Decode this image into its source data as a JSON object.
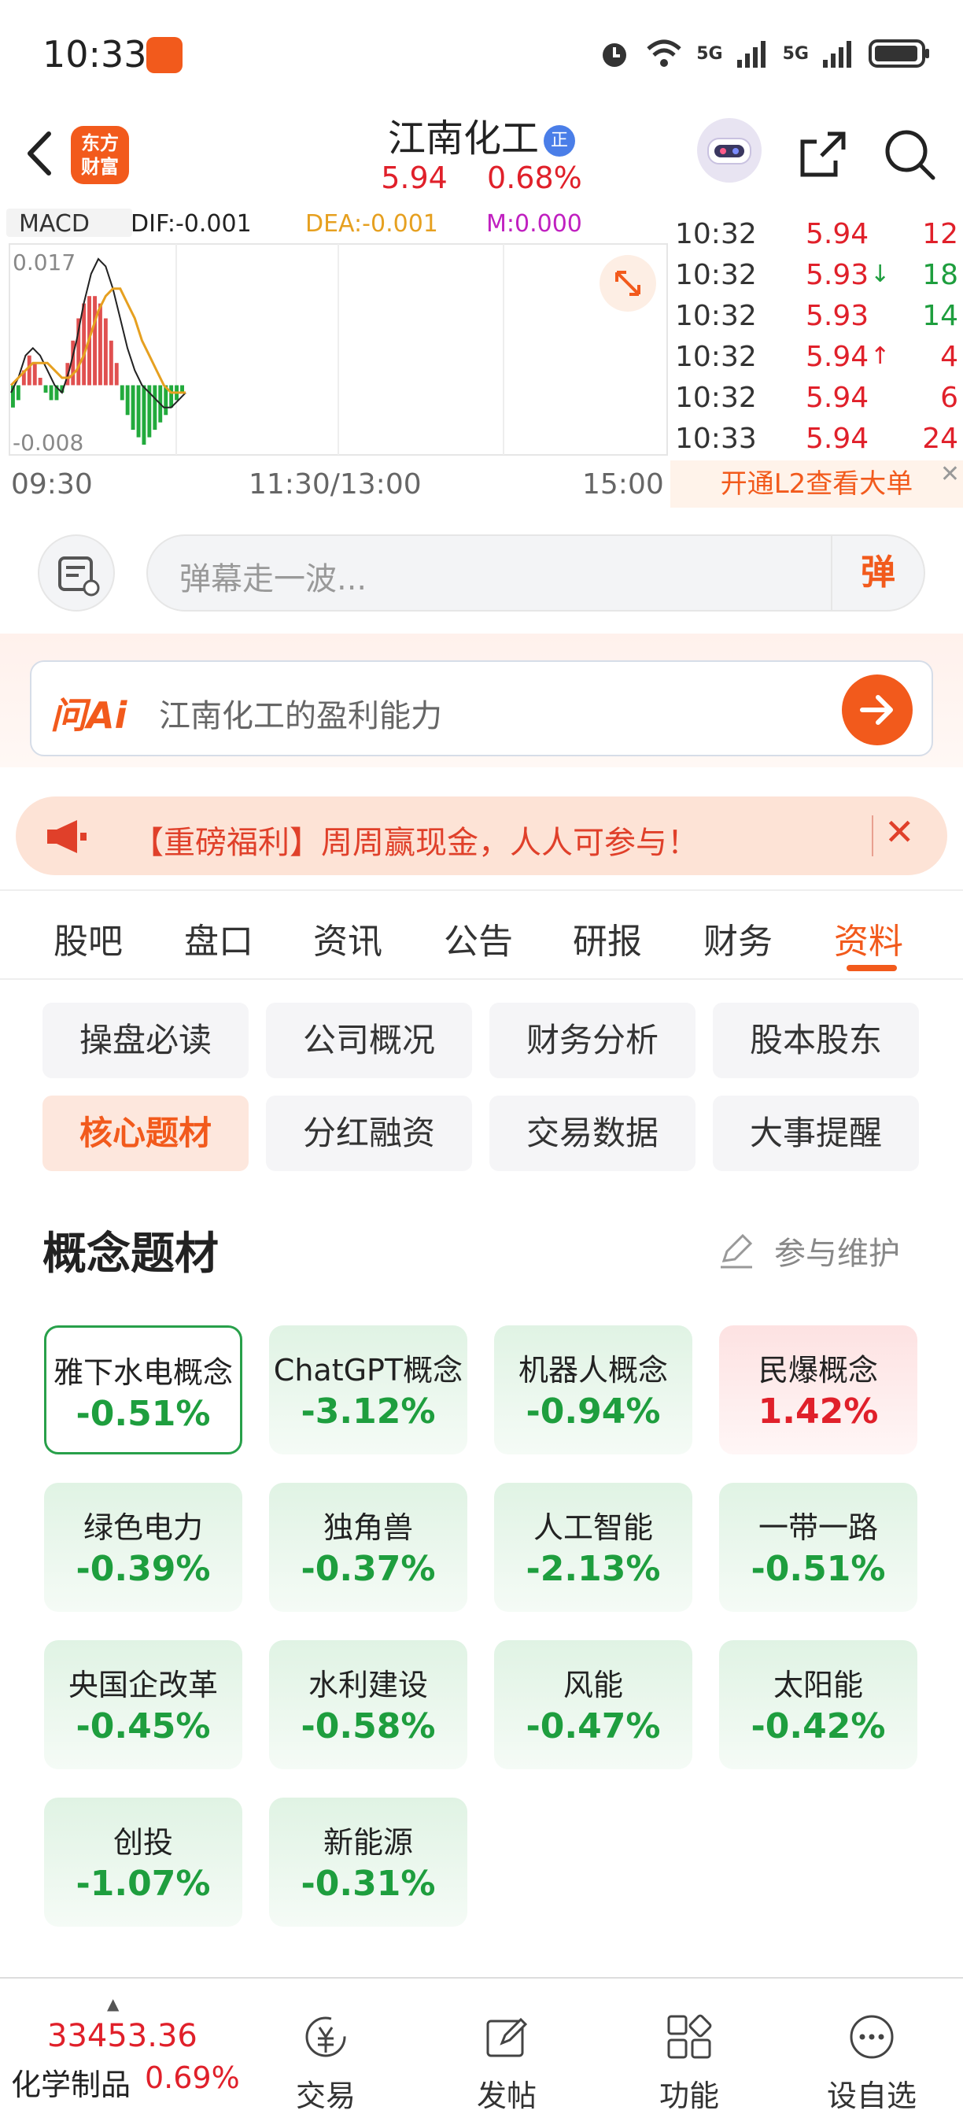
{
  "status_bar": {
    "time": "10:33",
    "net1": "5G",
    "net2": "5G"
  },
  "header": {
    "logo_text": [
      "东方",
      "财富"
    ],
    "stock_name": "江南化工",
    "badge": "正",
    "price": "5.94",
    "change_pct": "0.68%"
  },
  "chart": {
    "indicator": "MACD",
    "dif_label": "DIF:-0.001",
    "dea_label": "DEA:-0.001",
    "m_label": "M:0.000",
    "y_max_label": "0.017",
    "y_min_label": "-0.008",
    "x_labels": [
      "09:30",
      "11:30/13:00",
      "15:00"
    ]
  },
  "chart_data": {
    "type": "bar",
    "title": "MACD",
    "xlabel": "",
    "ylabel": "",
    "ylim": [
      -0.008,
      0.017
    ],
    "x_ticks": [
      "09:30",
      "11:30/13:00",
      "15:00"
    ],
    "histogram": [
      -0.003,
      -0.002,
      0.002,
      0.004,
      0.003,
      0.001,
      -0.001,
      -0.002,
      -0.002,
      -0.001,
      0.003,
      0.006,
      0.009,
      0.011,
      0.012,
      0.012,
      0.011,
      0.009,
      0.006,
      0.003,
      -0.002,
      -0.004,
      -0.006,
      -0.007,
      -0.008,
      -0.007,
      -0.006,
      -0.005,
      -0.004,
      -0.003,
      -0.002,
      -0.001
    ],
    "series": [
      {
        "name": "DIF",
        "values": [
          -0.001,
          0.001,
          0.004,
          0.005,
          0.004,
          0.002,
          0.0,
          -0.001,
          0.002,
          0.006,
          0.011,
          0.015,
          0.017,
          0.016,
          0.013,
          0.009,
          0.005,
          0.002,
          0.0,
          -0.001,
          -0.002,
          -0.003,
          -0.003,
          -0.002,
          -0.001
        ]
      },
      {
        "name": "DEA",
        "values": [
          0.0,
          0.001,
          0.002,
          0.003,
          0.003,
          0.003,
          0.002,
          0.001,
          0.001,
          0.002,
          0.004,
          0.007,
          0.01,
          0.012,
          0.013,
          0.013,
          0.011,
          0.009,
          0.006,
          0.004,
          0.002,
          0.0,
          -0.001,
          -0.001,
          -0.001
        ]
      }
    ]
  },
  "trades": [
    {
      "time": "10:32",
      "price": "5.94",
      "volume": "12",
      "dir": ""
    },
    {
      "time": "10:32",
      "price": "5.93",
      "volume": "18",
      "dir": "down"
    },
    {
      "time": "10:32",
      "price": "5.93",
      "volume": "14",
      "dir": ""
    },
    {
      "time": "10:32",
      "price": "5.94",
      "volume": "4",
      "dir": "up"
    },
    {
      "time": "10:32",
      "price": "5.94",
      "volume": "6",
      "dir": ""
    },
    {
      "time": "10:33",
      "price": "5.94",
      "volume": "24",
      "dir": ""
    }
  ],
  "l2_banner": "开通L2查看大单",
  "danmu": {
    "placeholder": "弹幕走一波...",
    "button": "弹"
  },
  "ai": {
    "logo": "问Ai",
    "question": "江南化工的盈利能力"
  },
  "promo": {
    "text": "【重磅福利】周周赢现金，人人可参与！"
  },
  "tabs": [
    "股吧",
    "盘口",
    "资讯",
    "公告",
    "研报",
    "财务",
    "资料"
  ],
  "active_tab": 6,
  "sub_buttons": [
    "操盘必读",
    "公司概况",
    "财务分析",
    "股本股东",
    "核心题材",
    "分红融资",
    "交易数据",
    "大事提醒"
  ],
  "active_sub": 4,
  "section": {
    "title": "概念题材",
    "maintain": "参与维护"
  },
  "concepts": [
    {
      "name": "雅下水电概念",
      "pct": "-0.51%",
      "kind": "selected"
    },
    {
      "name": "ChatGPT概念",
      "pct": "-3.12%",
      "kind": "green"
    },
    {
      "name": "机器人概念",
      "pct": "-0.94%",
      "kind": "green"
    },
    {
      "name": "民爆概念",
      "pct": "1.42%",
      "kind": "red"
    },
    {
      "name": "绿色电力",
      "pct": "-0.39%",
      "kind": "green"
    },
    {
      "name": "独角兽",
      "pct": "-0.37%",
      "kind": "green"
    },
    {
      "name": "人工智能",
      "pct": "-2.13%",
      "kind": "green"
    },
    {
      "name": "一带一路",
      "pct": "-0.51%",
      "kind": "green"
    },
    {
      "name": "央国企改革",
      "pct": "-0.45%",
      "kind": "green"
    },
    {
      "name": "水利建设",
      "pct": "-0.58%",
      "kind": "green"
    },
    {
      "name": "风能",
      "pct": "-0.47%",
      "kind": "green"
    },
    {
      "name": "太阳能",
      "pct": "-0.42%",
      "kind": "green"
    },
    {
      "name": "创投",
      "pct": "-1.07%",
      "kind": "green"
    },
    {
      "name": "新能源",
      "pct": "-0.31%",
      "kind": "green"
    }
  ],
  "bottom": {
    "index_value": "33453.36",
    "index_name": "化学制品",
    "index_pct": "0.69%",
    "nav": [
      "交易",
      "发帖",
      "功能",
      "设自选"
    ]
  },
  "colors": {
    "accent": "#f25a1c",
    "up": "#e0202a",
    "down": "#1e9e3e"
  }
}
